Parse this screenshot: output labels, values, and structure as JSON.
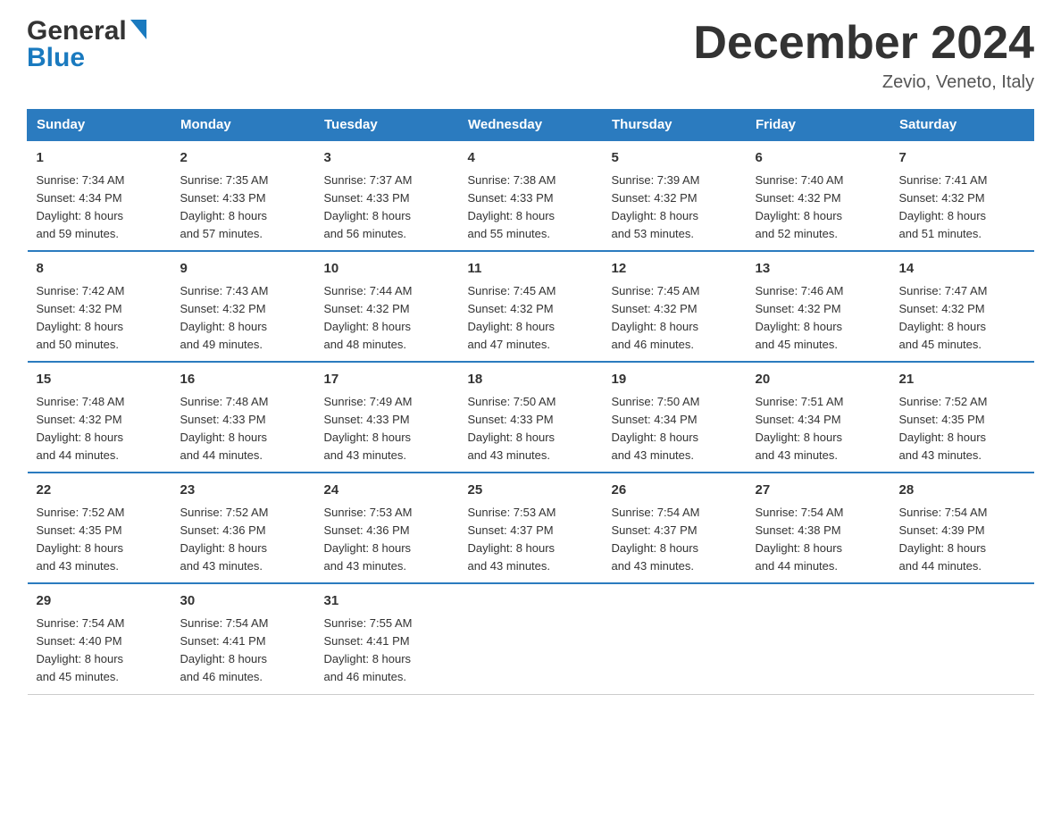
{
  "header": {
    "logo": {
      "general": "General",
      "blue": "Blue",
      "arrow_color": "#1a7abf"
    },
    "title": "December 2024",
    "subtitle": "Zevio, Veneto, Italy"
  },
  "weekdays": [
    "Sunday",
    "Monday",
    "Tuesday",
    "Wednesday",
    "Thursday",
    "Friday",
    "Saturday"
  ],
  "weeks": [
    [
      {
        "day": "1",
        "sunrise": "7:34 AM",
        "sunset": "4:34 PM",
        "daylight": "8 hours and 59 minutes."
      },
      {
        "day": "2",
        "sunrise": "7:35 AM",
        "sunset": "4:33 PM",
        "daylight": "8 hours and 57 minutes."
      },
      {
        "day": "3",
        "sunrise": "7:37 AM",
        "sunset": "4:33 PM",
        "daylight": "8 hours and 56 minutes."
      },
      {
        "day": "4",
        "sunrise": "7:38 AM",
        "sunset": "4:33 PM",
        "daylight": "8 hours and 55 minutes."
      },
      {
        "day": "5",
        "sunrise": "7:39 AM",
        "sunset": "4:32 PM",
        "daylight": "8 hours and 53 minutes."
      },
      {
        "day": "6",
        "sunrise": "7:40 AM",
        "sunset": "4:32 PM",
        "daylight": "8 hours and 52 minutes."
      },
      {
        "day": "7",
        "sunrise": "7:41 AM",
        "sunset": "4:32 PM",
        "daylight": "8 hours and 51 minutes."
      }
    ],
    [
      {
        "day": "8",
        "sunrise": "7:42 AM",
        "sunset": "4:32 PM",
        "daylight": "8 hours and 50 minutes."
      },
      {
        "day": "9",
        "sunrise": "7:43 AM",
        "sunset": "4:32 PM",
        "daylight": "8 hours and 49 minutes."
      },
      {
        "day": "10",
        "sunrise": "7:44 AM",
        "sunset": "4:32 PM",
        "daylight": "8 hours and 48 minutes."
      },
      {
        "day": "11",
        "sunrise": "7:45 AM",
        "sunset": "4:32 PM",
        "daylight": "8 hours and 47 minutes."
      },
      {
        "day": "12",
        "sunrise": "7:45 AM",
        "sunset": "4:32 PM",
        "daylight": "8 hours and 46 minutes."
      },
      {
        "day": "13",
        "sunrise": "7:46 AM",
        "sunset": "4:32 PM",
        "daylight": "8 hours and 45 minutes."
      },
      {
        "day": "14",
        "sunrise": "7:47 AM",
        "sunset": "4:32 PM",
        "daylight": "8 hours and 45 minutes."
      }
    ],
    [
      {
        "day": "15",
        "sunrise": "7:48 AM",
        "sunset": "4:32 PM",
        "daylight": "8 hours and 44 minutes."
      },
      {
        "day": "16",
        "sunrise": "7:48 AM",
        "sunset": "4:33 PM",
        "daylight": "8 hours and 44 minutes."
      },
      {
        "day": "17",
        "sunrise": "7:49 AM",
        "sunset": "4:33 PM",
        "daylight": "8 hours and 43 minutes."
      },
      {
        "day": "18",
        "sunrise": "7:50 AM",
        "sunset": "4:33 PM",
        "daylight": "8 hours and 43 minutes."
      },
      {
        "day": "19",
        "sunrise": "7:50 AM",
        "sunset": "4:34 PM",
        "daylight": "8 hours and 43 minutes."
      },
      {
        "day": "20",
        "sunrise": "7:51 AM",
        "sunset": "4:34 PM",
        "daylight": "8 hours and 43 minutes."
      },
      {
        "day": "21",
        "sunrise": "7:52 AM",
        "sunset": "4:35 PM",
        "daylight": "8 hours and 43 minutes."
      }
    ],
    [
      {
        "day": "22",
        "sunrise": "7:52 AM",
        "sunset": "4:35 PM",
        "daylight": "8 hours and 43 minutes."
      },
      {
        "day": "23",
        "sunrise": "7:52 AM",
        "sunset": "4:36 PM",
        "daylight": "8 hours and 43 minutes."
      },
      {
        "day": "24",
        "sunrise": "7:53 AM",
        "sunset": "4:36 PM",
        "daylight": "8 hours and 43 minutes."
      },
      {
        "day": "25",
        "sunrise": "7:53 AM",
        "sunset": "4:37 PM",
        "daylight": "8 hours and 43 minutes."
      },
      {
        "day": "26",
        "sunrise": "7:54 AM",
        "sunset": "4:37 PM",
        "daylight": "8 hours and 43 minutes."
      },
      {
        "day": "27",
        "sunrise": "7:54 AM",
        "sunset": "4:38 PM",
        "daylight": "8 hours and 44 minutes."
      },
      {
        "day": "28",
        "sunrise": "7:54 AM",
        "sunset": "4:39 PM",
        "daylight": "8 hours and 44 minutes."
      }
    ],
    [
      {
        "day": "29",
        "sunrise": "7:54 AM",
        "sunset": "4:40 PM",
        "daylight": "8 hours and 45 minutes."
      },
      {
        "day": "30",
        "sunrise": "7:54 AM",
        "sunset": "4:41 PM",
        "daylight": "8 hours and 46 minutes."
      },
      {
        "day": "31",
        "sunrise": "7:55 AM",
        "sunset": "4:41 PM",
        "daylight": "8 hours and 46 minutes."
      },
      null,
      null,
      null,
      null
    ]
  ],
  "labels": {
    "sunrise": "Sunrise:",
    "sunset": "Sunset:",
    "daylight": "Daylight:"
  }
}
